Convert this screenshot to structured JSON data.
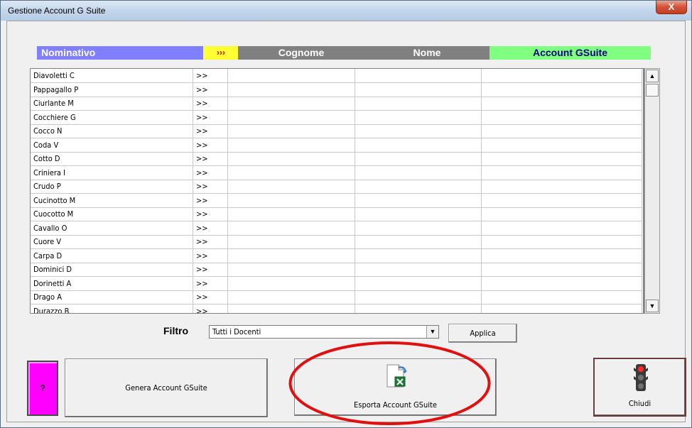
{
  "window": {
    "title": "Gestione Account G Suite",
    "close_label": "X"
  },
  "header": {
    "nominativo": "Nominativo",
    "arrow": "›››",
    "cognome": "Cognome",
    "nome": "Nome",
    "account": "Account GSuite"
  },
  "rows": [
    {
      "nominativo": "Diavoletti C",
      "arrow": ">>",
      "cognome": "",
      "nome": "",
      "account": ""
    },
    {
      "nominativo": "Pappagallo P",
      "arrow": ">>",
      "cognome": "",
      "nome": "",
      "account": ""
    },
    {
      "nominativo": "Ciurlante M",
      "arrow": ">>",
      "cognome": "",
      "nome": "",
      "account": ""
    },
    {
      "nominativo": "Cocchiere G",
      "arrow": ">>",
      "cognome": "",
      "nome": "",
      "account": ""
    },
    {
      "nominativo": "Cocco N",
      "arrow": ">>",
      "cognome": "",
      "nome": "",
      "account": ""
    },
    {
      "nominativo": "Coda V",
      "arrow": ">>",
      "cognome": "",
      "nome": "",
      "account": ""
    },
    {
      "nominativo": "Cotto D",
      "arrow": ">>",
      "cognome": "",
      "nome": "",
      "account": ""
    },
    {
      "nominativo": "Criniera I",
      "arrow": ">>",
      "cognome": "",
      "nome": "",
      "account": ""
    },
    {
      "nominativo": "Crudo P",
      "arrow": ">>",
      "cognome": "",
      "nome": "",
      "account": ""
    },
    {
      "nominativo": "Cucinotto M",
      "arrow": ">>",
      "cognome": "",
      "nome": "",
      "account": ""
    },
    {
      "nominativo": "Cuocotto M",
      "arrow": ">>",
      "cognome": "",
      "nome": "",
      "account": ""
    },
    {
      "nominativo": "Cavallo O",
      "arrow": ">>",
      "cognome": "",
      "nome": "",
      "account": ""
    },
    {
      "nominativo": "Cuore V",
      "arrow": ">>",
      "cognome": "",
      "nome": "",
      "account": ""
    },
    {
      "nominativo": "Carpa D",
      "arrow": ">>",
      "cognome": "",
      "nome": "",
      "account": ""
    },
    {
      "nominativo": "Dominici D",
      "arrow": ">>",
      "cognome": "",
      "nome": "",
      "account": ""
    },
    {
      "nominativo": "Dorinetti A",
      "arrow": ">>",
      "cognome": "",
      "nome": "",
      "account": ""
    },
    {
      "nominativo": "Drago A",
      "arrow": ">>",
      "cognome": "",
      "nome": "",
      "account": ""
    },
    {
      "nominativo": "Durazzo B",
      "arrow": ">>",
      "cognome": "",
      "nome": "",
      "account": ""
    }
  ],
  "scrollbar": {
    "up": "▲",
    "down": "▼"
  },
  "filter": {
    "label": "Filtro",
    "value": "Tutti i Docenti",
    "drop": "▼",
    "apply_label": "Applica"
  },
  "buttons": {
    "help_label": "?",
    "genera_label": "Genera Account GSuite",
    "esporta_label": "Esporta Account GSuite",
    "chiudi_label": "Chiudi"
  },
  "icons": {
    "export": "excel-export-icon",
    "close": "traffic-light-icon"
  },
  "colors": {
    "nominativo_header": "#7f7fff",
    "arrow_header": "#ffff33",
    "gray_header": "#808080",
    "account_header": "#80ff80",
    "help_button": "#ff00ff",
    "highlight": "#e01010"
  }
}
